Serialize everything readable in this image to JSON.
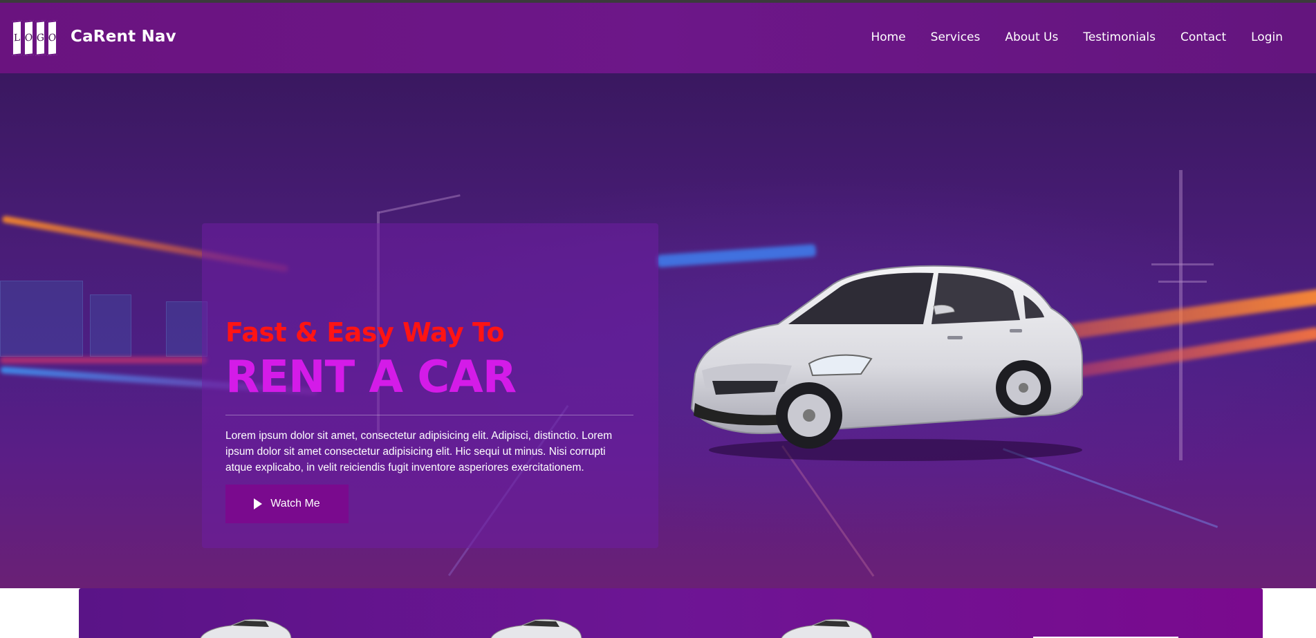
{
  "navbar": {
    "logo_letters": [
      "L",
      "O",
      "G",
      "O"
    ],
    "brand": "CaRent Nav",
    "links": [
      "Home",
      "Services",
      "About Us",
      "Testimonials",
      "Contact",
      "Login"
    ]
  },
  "hero": {
    "tagline": "Fast & Easy Way To",
    "headline": "RENT A CAR",
    "description": "Lorem ipsum dolor sit amet, consectetur adipisicing elit. Adipisci, distinctio. Lorem ipsum dolor sit amet consectetur adipisicing elit. Hic sequi ut minus. Nisi corrupti atque explicabo, in velit reiciendis fugit inventore asperiores exercitationem.",
    "watch_button": "Watch Me",
    "car_icon": "car-image"
  },
  "colors": {
    "accent": "#d41be8",
    "tagline": "#ff1414",
    "navbar": "#6a137f",
    "button": "#7a0a8e"
  }
}
